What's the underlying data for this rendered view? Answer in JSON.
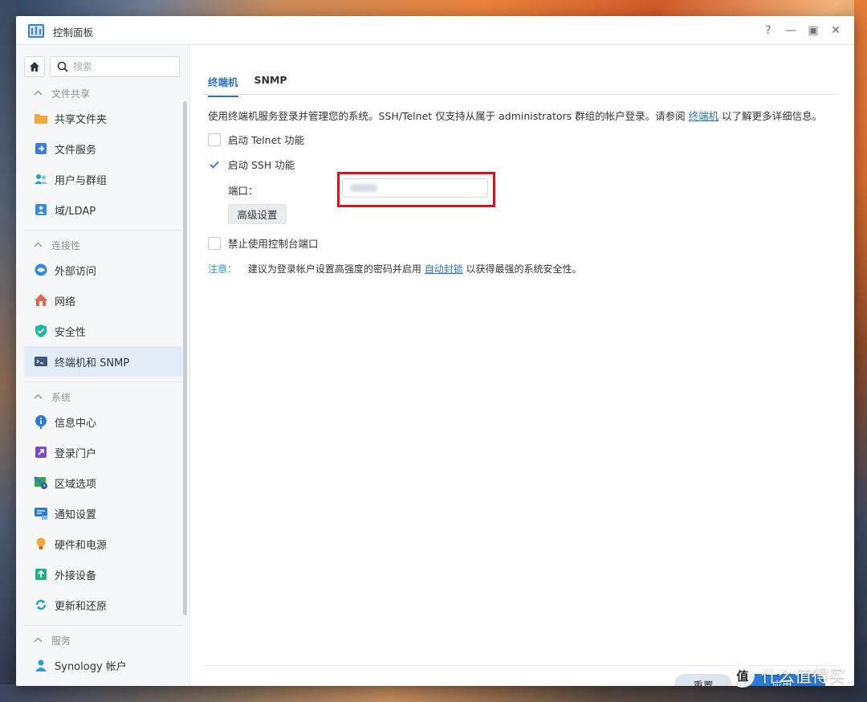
{
  "window": {
    "title": "控制面板",
    "controls": {
      "help": "?",
      "minimize": "—",
      "maximize": "▣",
      "close": "✕"
    }
  },
  "sidebar": {
    "search_placeholder": "搜索",
    "sections": [
      {
        "header": "文件共享",
        "items": [
          {
            "label": "共享文件夹",
            "icon": "shared-folder-icon",
            "color": "#f0a93b"
          },
          {
            "label": "文件服务",
            "icon": "file-services-icon",
            "color": "#3a7fd0"
          },
          {
            "label": "用户与群组",
            "icon": "users-groups-icon",
            "color": "#2a9bd5"
          },
          {
            "label": "域/LDAP",
            "icon": "domain-ldap-icon",
            "color": "#3a8ad8"
          }
        ]
      },
      {
        "header": "连接性",
        "items": [
          {
            "label": "外部访问",
            "icon": "external-access-icon",
            "color": "#3a8ad8"
          },
          {
            "label": "网络",
            "icon": "network-icon",
            "color": "#e0674a"
          },
          {
            "label": "安全性",
            "icon": "security-shield-icon",
            "color": "#1fb8a6"
          },
          {
            "label": "终端机和 SNMP",
            "icon": "terminal-icon",
            "color": "#3e5a78",
            "active": true
          }
        ]
      },
      {
        "header": "系统",
        "items": [
          {
            "label": "信息中心",
            "icon": "info-center-icon",
            "color": "#2a7ad6"
          },
          {
            "label": "登录门户",
            "icon": "login-portal-icon",
            "color": "#7a4bc6"
          },
          {
            "label": "区域选项",
            "icon": "regional-options-icon",
            "color": "#3aa44a"
          },
          {
            "label": "通知设置",
            "icon": "notification-icon",
            "color": "#2a7ad6"
          },
          {
            "label": "硬件和电源",
            "icon": "hardware-power-icon",
            "color": "#f0a93b"
          },
          {
            "label": "外接设备",
            "icon": "external-devices-icon",
            "color": "#1fb08a"
          },
          {
            "label": "更新和还原",
            "icon": "update-restore-icon",
            "color": "#1fa0c0"
          }
        ]
      },
      {
        "header": "服务",
        "items": [
          {
            "label": "Synology 帐户",
            "icon": "synology-account-icon",
            "color": "#2a9bd5"
          }
        ]
      }
    ]
  },
  "tabs": [
    {
      "label": "终端机",
      "active": true
    },
    {
      "label": "SNMP",
      "active": false
    }
  ],
  "terminal": {
    "description_pre": "使用终端机服务登录并管理您的系统。SSH/Telnet 仅支持从属于 administrators 群组的帐户登录。请参阅",
    "description_link": "终端机",
    "description_post": "以了解更多详细信息。",
    "enable_telnet": {
      "label": "启动 Telnet 功能",
      "checked": false
    },
    "enable_ssh": {
      "label": "启动 SSH 功能",
      "checked": true
    },
    "port_label": "端口：",
    "advanced_button": "高级设置",
    "disable_console": {
      "label": "禁止使用控制台端口",
      "checked": false
    },
    "note_label": "注意：",
    "note_pre": "建议为登录帐户设置高强度的密码并启用",
    "note_link": "自动封锁",
    "note_post": "以获得最强的系统安全性。"
  },
  "footer": {
    "reset_button": "重置",
    "apply_button": "应用"
  },
  "watermark": {
    "badge": "值",
    "text": "什么值得买"
  },
  "colors": {
    "accent": "#2a72c0",
    "highlight_box": "#d7161c",
    "apply_bg": "#2a7ad6",
    "active_item_bg": "#e2ecf6"
  }
}
